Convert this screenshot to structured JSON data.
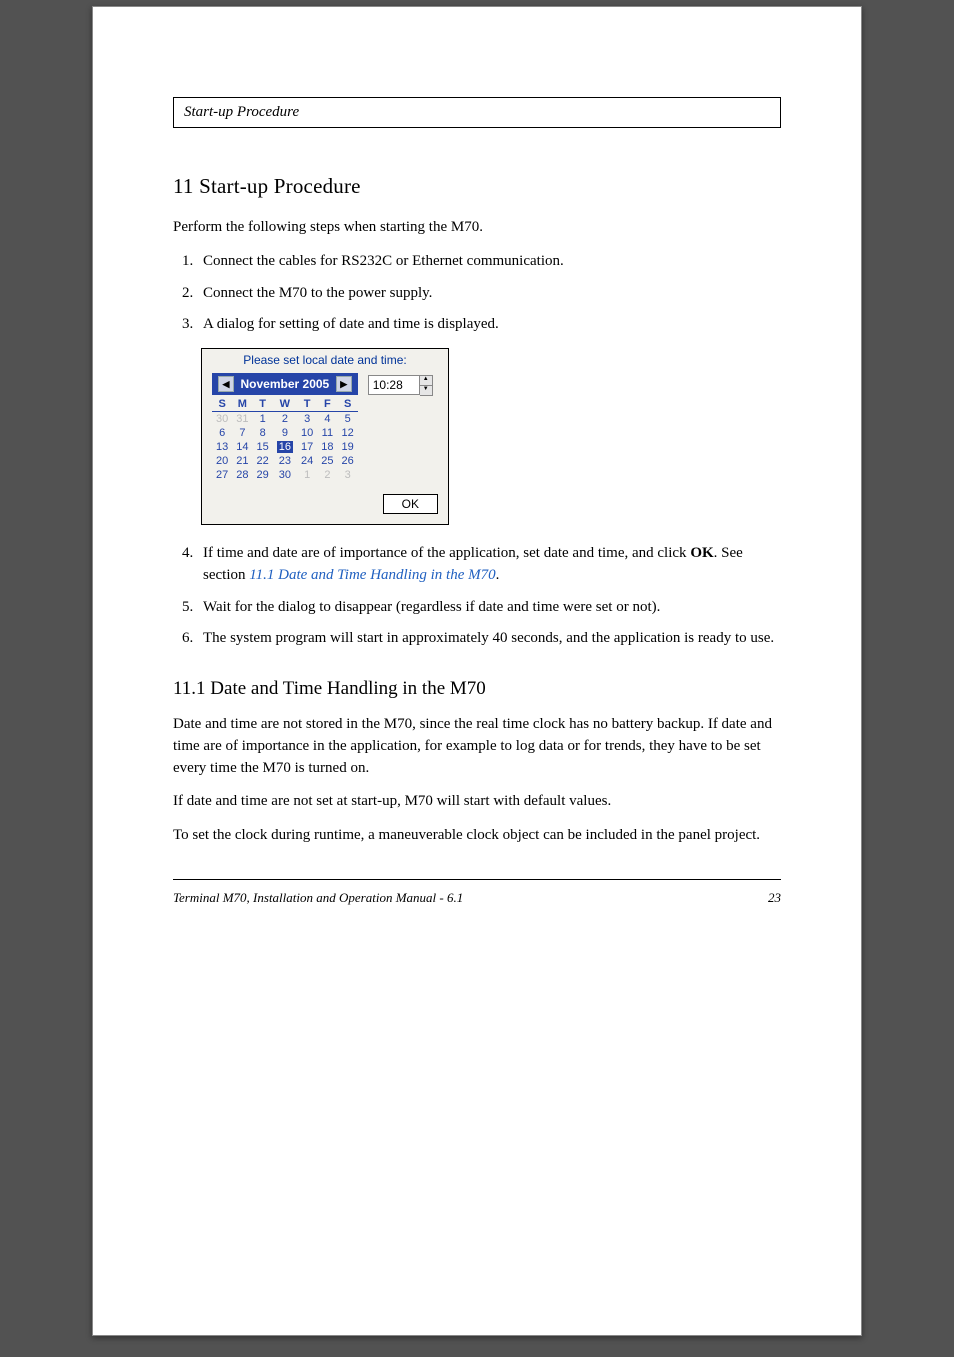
{
  "header": {
    "title": "Start-up Procedure"
  },
  "section11": {
    "title": "11  Start-up Procedure",
    "intro": "Perform the following steps when starting the M70.",
    "steps123": [
      "Connect the cables for RS232C or Ethernet communication.",
      "Connect the M70 to the power supply.",
      "A dialog for setting of date and time is displayed."
    ],
    "step4_pre": "If time and date are of importance of the application, set date and time, and click ",
    "step4_bold": "OK",
    "step4_post": ". See section  ",
    "step4_link": "11.1 Date and Time Handling in the M70",
    "step4_end": ".",
    "step5": "Wait for the dialog to disappear (regardless if date and time were set or not).",
    "step6": "The system program will start in approximately 40 seconds, and the application is ready to use."
  },
  "dialog": {
    "title": "Please set local date and time:",
    "month_label": "November 2005",
    "weekdays": [
      "S",
      "M",
      "T",
      "W",
      "T",
      "F",
      "S"
    ],
    "weeks": [
      [
        {
          "d": "30",
          "dim": true
        },
        {
          "d": "31",
          "dim": true
        },
        {
          "d": "1"
        },
        {
          "d": "2"
        },
        {
          "d": "3"
        },
        {
          "d": "4"
        },
        {
          "d": "5"
        }
      ],
      [
        {
          "d": "6"
        },
        {
          "d": "7"
        },
        {
          "d": "8"
        },
        {
          "d": "9"
        },
        {
          "d": "10"
        },
        {
          "d": "11"
        },
        {
          "d": "12"
        }
      ],
      [
        {
          "d": "13"
        },
        {
          "d": "14"
        },
        {
          "d": "15"
        },
        {
          "d": "16",
          "sel": true
        },
        {
          "d": "17"
        },
        {
          "d": "18"
        },
        {
          "d": "19"
        }
      ],
      [
        {
          "d": "20"
        },
        {
          "d": "21"
        },
        {
          "d": "22"
        },
        {
          "d": "23"
        },
        {
          "d": "24"
        },
        {
          "d": "25"
        },
        {
          "d": "26"
        }
      ],
      [
        {
          "d": "27"
        },
        {
          "d": "28"
        },
        {
          "d": "29"
        },
        {
          "d": "30"
        },
        {
          "d": "1",
          "dim": true
        },
        {
          "d": "2",
          "dim": true
        },
        {
          "d": "3",
          "dim": true
        }
      ]
    ],
    "time_value": "10:28",
    "ok_label": "OK"
  },
  "section11_1": {
    "title": "11.1 Date and Time Handling in the M70",
    "p1": "Date and time are not stored in the M70, since the real time clock has no battery backup. If date and time are of importance in the application, for example to log data or for trends, they have to be set every time the M70 is turned on.",
    "p2": "If date and time are not set at start-up, M70 will start with default values.",
    "p3": "To set the clock during runtime, a maneuverable clock object can be included in the panel project."
  },
  "footer": {
    "left": "Terminal M70, Installation and Operation Manual - 6.1",
    "right": "23"
  }
}
